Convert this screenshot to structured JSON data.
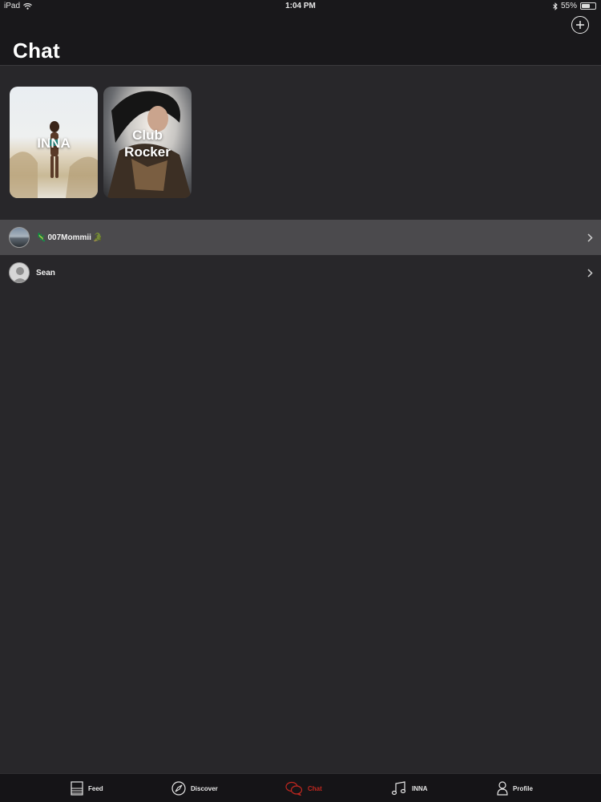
{
  "status_bar": {
    "device": "iPad",
    "time": "1:04 PM",
    "battery": "55%",
    "battery_level": 0.55
  },
  "header": {
    "title": "Chat",
    "add_icon": "plus-circle-icon"
  },
  "cards": [
    {
      "label": "INNA"
    },
    {
      "label": "Club Rocker"
    }
  ],
  "chats": [
    {
      "name": "007Mommii",
      "prefix_emoji": "🦎",
      "suffix_emoji": "🐊",
      "selected": true
    },
    {
      "name": "Sean",
      "selected": false
    }
  ],
  "tabs": [
    {
      "label": "Feed",
      "icon": "feed-icon"
    },
    {
      "label": "Discover",
      "icon": "compass-icon"
    },
    {
      "label": "Chat",
      "icon": "chat-bubbles-icon",
      "active": true
    },
    {
      "label": "INNA",
      "icon": "music-note-icon"
    },
    {
      "label": "Profile",
      "icon": "person-icon"
    }
  ],
  "colors": {
    "accent": "#c0271f",
    "background": "#28272a",
    "bar": "#19181b",
    "selected_row": "#4b4a4d"
  }
}
